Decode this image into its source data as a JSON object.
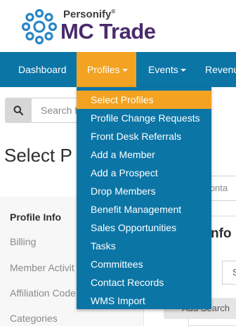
{
  "brand": {
    "small": "Personify",
    "reg": "®",
    "name": "MC Trade"
  },
  "colors": {
    "nav": "#0b75a6",
    "accent": "#f3a321",
    "brand_purple": "#4a2a6b",
    "logo_blue": "#2a86c6"
  },
  "nav": {
    "items": [
      {
        "label": "Dashboard",
        "has_caret": false
      },
      {
        "label": "Profiles",
        "has_caret": true,
        "active": true
      },
      {
        "label": "Events",
        "has_caret": true
      },
      {
        "label": "Revenu",
        "has_caret": false
      }
    ]
  },
  "search": {
    "icon": "search-icon",
    "placeholder": "Search f"
  },
  "page": {
    "title": "Select P"
  },
  "sidebar": {
    "items": [
      {
        "label": "Profile Info",
        "active": true
      },
      {
        "label": "Billing"
      },
      {
        "label": "Member Activit"
      },
      {
        "label": "Affiliation Code"
      },
      {
        "label": "Categories"
      }
    ]
  },
  "right": {
    "input_text": "rconta",
    "card_title": "nfo",
    "select_text": "S",
    "add_button": "Add Search"
  },
  "dropdown": {
    "items": [
      "Select Profiles",
      "Profile Change Requests",
      "Front Desk Referrals",
      "Add a Member",
      "Add a Prospect",
      "Drop Members",
      "Benefit Management",
      "Sales Opportunities",
      "Tasks",
      "Committees",
      "Contact Records",
      "WMS Import"
    ],
    "highlighted_index": 0
  }
}
